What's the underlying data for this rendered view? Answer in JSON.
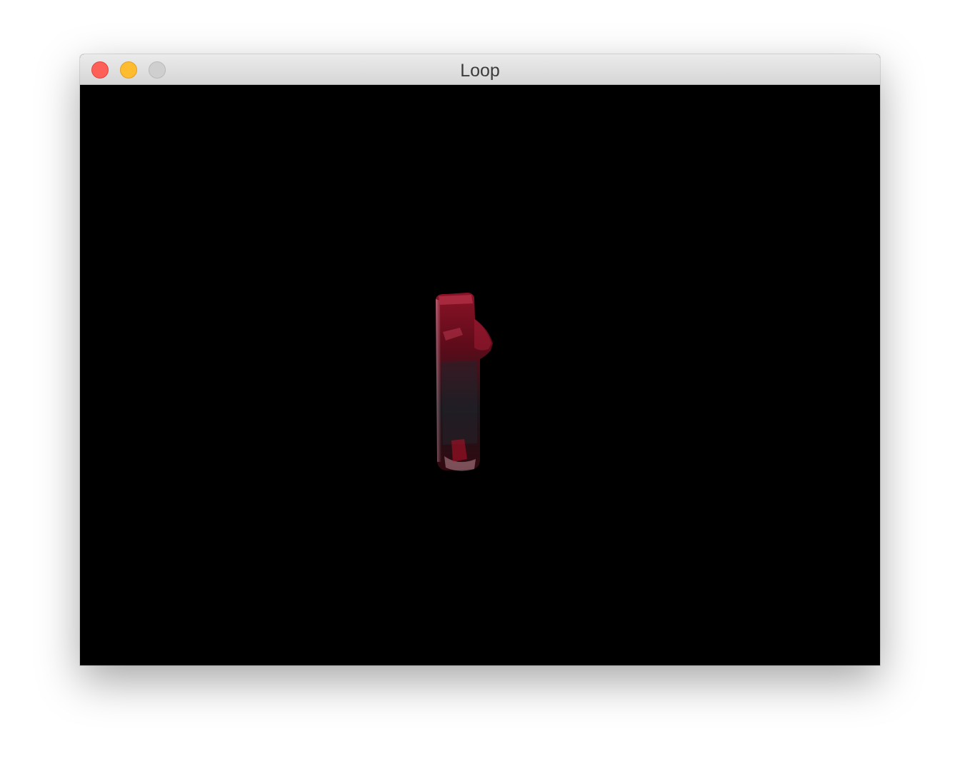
{
  "window": {
    "title": "Loop"
  },
  "controls": {
    "close_icon": "close-icon",
    "minimize_icon": "minimize-icon",
    "zoom_icon": "zoom-icon"
  },
  "colors": {
    "close": "#fe5f57",
    "minimize": "#febc2e",
    "zoom_disabled": "#cfcfcf",
    "canvas_background": "#000000",
    "figure_red": "#8a0f22"
  }
}
